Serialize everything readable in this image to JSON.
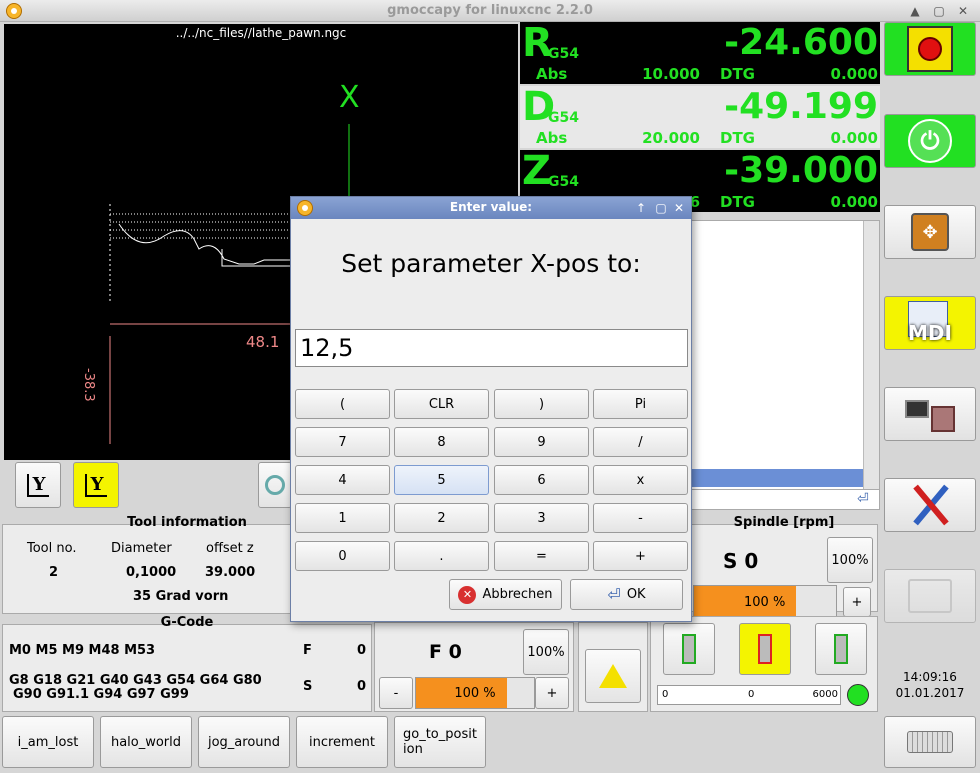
{
  "window": {
    "title": "gmoccapy for linuxcnc  2.2.0"
  },
  "preview": {
    "filename": "../../nc_files//lathe_pawn.ngc",
    "axis_marker": "X",
    "dim_horizontal": "48.1",
    "dim_vertical": "-38.3"
  },
  "dro": [
    {
      "axis": "R",
      "coord": "G54",
      "value": "-24.600",
      "abs_label": "Abs",
      "abs_value": "10.000",
      "dtg_label": "DTG",
      "dtg_value": "0.000"
    },
    {
      "axis": "D",
      "coord": "G54",
      "value": "-49.199",
      "abs_label": "Abs",
      "abs_value": "20.000",
      "dtg_label": "DTG",
      "dtg_value": "0.000"
    },
    {
      "axis": "Z",
      "coord": "G54",
      "value": "-39.000",
      "abs_label": "Abs",
      "abs_value": "",
      "dtg_label": "DTG",
      "dtg_value": "0.000",
      "abs_partial": "6"
    }
  ],
  "side_buttons": {
    "estop": "estop-icon",
    "power": "power-icon",
    "jog": "jog-arrows-icon",
    "mdi": "MDI",
    "auto": "machine-auto-icon",
    "settings": "tools-settings-icon",
    "user": "user-tabs-icon",
    "clock_time": "14:09:16",
    "clock_date": "01.01.2017",
    "keyboard": "keyboard-icon"
  },
  "view_buttons": {
    "y": "Y",
    "y_tool": "Y"
  },
  "tool_info": {
    "title": "Tool information",
    "headers": [
      "Tool no.",
      "Diameter",
      "offset z"
    ],
    "values": [
      "2",
      "0,1000",
      "39.000"
    ],
    "description": "35 Grad vorn"
  },
  "gcode": {
    "title": "G-Code",
    "mcodes": "M0 M5 M9 M48 M53",
    "gcodes_line1": "G8 G18 G21 G40 G43 G54 G64 G80",
    "gcodes_line2": "G90 G91.1 G94 G97 G99",
    "f_label": "F",
    "f_value": "0",
    "s_label": "S",
    "s_value": "0"
  },
  "feed": {
    "label": "F  0",
    "override_btn": "100%",
    "minus": "-",
    "plus": "+",
    "bar_text": "100 %",
    "bar_fraction": 0.5
  },
  "spindle": {
    "title": "Spindle [rpm]",
    "speed": "S 0",
    "override_btn": "100%",
    "plus": "+",
    "bar_text": "100 %",
    "bar_fraction": 0.72,
    "scale_min": "0",
    "scale_mid": "0",
    "scale_max": "6000",
    "led_color": "#22e022"
  },
  "macros": [
    "i_am_lost",
    "halo_world",
    "jog_around",
    "increment",
    "go_to_position"
  ],
  "dialog": {
    "title": "Enter value:",
    "message": "Set parameter X-pos to:",
    "value": "12,5",
    "keys": [
      [
        "(",
        "CLR",
        ")",
        "Pi"
      ],
      [
        "7",
        "8",
        "9",
        "/"
      ],
      [
        "4",
        "5",
        "6",
        "x"
      ],
      [
        "1",
        "2",
        "3",
        "-"
      ],
      [
        "0",
        ".",
        "=",
        "+"
      ]
    ],
    "cancel": "Abbrechen",
    "ok": "OK"
  },
  "colors": {
    "dro_green": "#22e022",
    "override_orange": "#f5901e",
    "highlight_yellow": "#f4f400"
  }
}
